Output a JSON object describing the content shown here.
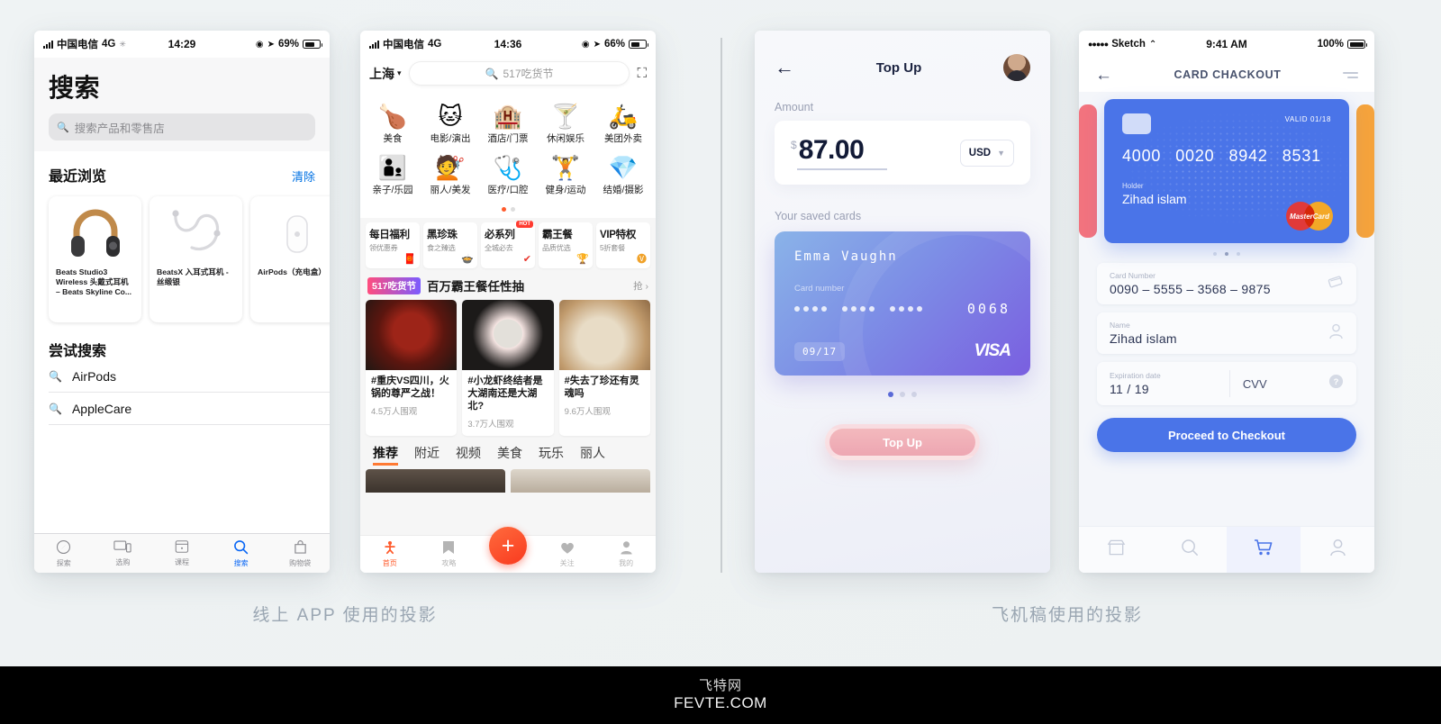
{
  "captions": {
    "left": "线上 APP 使用的投影",
    "right": "飞机稿使用的投影"
  },
  "watermark": {
    "cn": "飞特网",
    "en": "FEVTE.COM"
  },
  "phone1": {
    "status": {
      "carrier": "中国电信",
      "network": "4G",
      "time": "14:29",
      "battery": "69%"
    },
    "page_title": "搜索",
    "search_placeholder": "搜索产品和零售店",
    "recent_title": "最近浏览",
    "clear_label": "清除",
    "cards": [
      {
        "name": "Beats Studio3 Wireless 头戴式耳机 – Beats Skyline Co..."
      },
      {
        "name": "BeatsX 入耳式耳机 - 丝缎银"
      },
      {
        "name": "AirPods（充电盒）"
      }
    ],
    "try_title": "尝试搜索",
    "suggestions": [
      "AirPods",
      "AppleCare"
    ],
    "tabs": [
      {
        "label": "探索",
        "icon": "compass-icon",
        "active": false
      },
      {
        "label": "选购",
        "icon": "devices-icon",
        "active": false
      },
      {
        "label": "课程",
        "icon": "calendar-icon",
        "active": false
      },
      {
        "label": "搜索",
        "icon": "search-icon",
        "active": true
      },
      {
        "label": "购物袋",
        "icon": "bag-icon",
        "active": false
      }
    ],
    "accent": "#0a67f5"
  },
  "phone2": {
    "status": {
      "carrier": "中国电信",
      "network": "4G",
      "time": "14:36",
      "battery": "66%"
    },
    "city": "上海",
    "search_text": "517吃货节",
    "scan_icon": "scan-icon",
    "grid": [
      {
        "label": "美食",
        "icon": "🍗"
      },
      {
        "label": "电影/演出",
        "icon": "🐱"
      },
      {
        "label": "酒店/门票",
        "icon": "🏨"
      },
      {
        "label": "休闲娱乐",
        "icon": "🍸"
      },
      {
        "label": "美团外卖",
        "icon": "🛵"
      },
      {
        "label": "亲子/乐园",
        "icon": "👨‍👦"
      },
      {
        "label": "丽人/美发",
        "icon": "💇"
      },
      {
        "label": "医疗/口腔",
        "icon": "🩺"
      },
      {
        "label": "健身/运动",
        "icon": "🏋"
      },
      {
        "label": "结婚/摄影",
        "icon": "💎"
      }
    ],
    "promos": [
      {
        "title": "每日福利",
        "sub": "领优惠券",
        "emoji": "🧧",
        "hot": ""
      },
      {
        "title": "黑珍珠",
        "sub": "食之臻选",
        "emoji": "🍲",
        "hot": ""
      },
      {
        "title": "必系列",
        "sub": "全城必去",
        "emoji": "✔",
        "hot": "HOT"
      },
      {
        "title": "霸王餐",
        "sub": "品质优选",
        "emoji": "🏆",
        "hot": ""
      },
      {
        "title": "VIP特权",
        "sub": "5折套餐",
        "emoji": "🅥",
        "hot": ""
      }
    ],
    "banner": {
      "tag": "517吃货节",
      "text": "百万霸王餐任性抽",
      "action": "抢 ›"
    },
    "feed": [
      {
        "title": "#重庆VS四川，火锅的尊严之战！",
        "views": "4.5万人围观"
      },
      {
        "title": "#小龙虾终结者是大湖南还是大湖北?",
        "views": "3.7万人围观"
      },
      {
        "title": "#失去了珍还有灵魂吗",
        "views": "9.6万人围观"
      }
    ],
    "tabs": [
      "推荐",
      "附近",
      "视频",
      "美食",
      "玩乐",
      "丽人"
    ],
    "active_tab": "推荐",
    "bottom_nav": [
      {
        "label": "首页",
        "active": true
      },
      {
        "label": "攻略",
        "active": false
      },
      {
        "label": "关注",
        "active": false
      },
      {
        "label": "我的",
        "active": false
      }
    ],
    "fab_icon": "plus-icon",
    "accent": "#ff5a2b"
  },
  "phone3": {
    "back_icon": "arrow-left-icon",
    "title": "Top Up",
    "avatar": "user-avatar",
    "amount_label": "Amount",
    "currency_symbol": "$",
    "amount_value": "87.00",
    "currency_code": "USD",
    "currency_chevron": "chevron-down-icon",
    "saved_cards_label": "Your saved cards",
    "card": {
      "holder": "Emma  Vaughn",
      "card_number_label": "Card number",
      "last4": "0068",
      "expiry": "09/17",
      "brand": "VISA"
    },
    "pager": {
      "count": 3,
      "active": 0
    },
    "button_label": "Top Up",
    "accent": "#5a6bd8"
  },
  "phone4": {
    "status": {
      "carrier": "Sketch",
      "time": "9:41 AM",
      "battery": "100%"
    },
    "back_icon": "arrow-left-icon",
    "title": "CARD CHACKOUT",
    "menu_icon": "hamburger-icon",
    "card": {
      "valid_label": "VALID",
      "valid_value": "01/18",
      "number_groups": [
        "4000",
        "0020",
        "8942",
        "8531"
      ],
      "holder_label": "Holder",
      "holder_name": "Zihad islam",
      "brand": "MasterCard"
    },
    "pager": {
      "count": 3,
      "active": 1
    },
    "fields": [
      {
        "label": "Card Number",
        "value": "0090 – 5555 – 3568 – 9875",
        "icon": "card-icon"
      },
      {
        "label": "Name",
        "value": "Zihad islam",
        "icon": "person-icon"
      }
    ],
    "expiry_field": {
      "label": "Expiration date",
      "value": "11 / 19"
    },
    "cvv_field": {
      "label": "CVV",
      "icon": "help-icon"
    },
    "cta_label": "Proceed to Checkout",
    "bottom_nav": [
      {
        "icon": "store-icon",
        "active": false
      },
      {
        "icon": "search-icon",
        "active": false
      },
      {
        "icon": "cart-icon",
        "active": true
      },
      {
        "icon": "person-icon",
        "active": false
      }
    ],
    "accent": "#4a74e8"
  }
}
